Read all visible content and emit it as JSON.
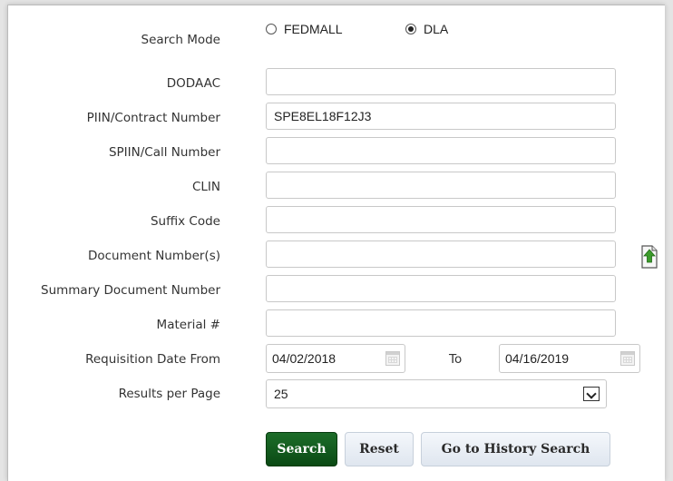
{
  "form": {
    "search_mode": {
      "label": "Search Mode",
      "options": [
        {
          "label": "FEDMALL",
          "checked": false
        },
        {
          "label": "DLA",
          "checked": true
        }
      ]
    },
    "dodaac": {
      "label": "DODAAC",
      "value": ""
    },
    "piin": {
      "label": "PIIN/Contract Number",
      "value": "SPE8EL18F12J3"
    },
    "spiin": {
      "label": "SPIIN/Call Number",
      "value": ""
    },
    "clin": {
      "label": "CLIN",
      "value": ""
    },
    "suffix": {
      "label": "Suffix Code",
      "value": ""
    },
    "document_numbers": {
      "label": "Document Number(s)",
      "value": ""
    },
    "summary_document": {
      "label": "Summary Document Number",
      "value": ""
    },
    "material": {
      "label": "Material #",
      "value": ""
    },
    "requisition_date": {
      "label": "Requisition Date From",
      "from": "04/02/2018",
      "to_label": "To",
      "to": "04/16/2019"
    },
    "results_per_page": {
      "label": "Results per Page",
      "value": "25"
    }
  },
  "buttons": {
    "search": "Search",
    "reset": "Reset",
    "history": "Go to History Search"
  },
  "icons": {
    "upload": "upload-document-icon",
    "calendar": "calendar-icon",
    "dropdown": "chevron-down-icon"
  },
  "colors": {
    "primary_button": "#0f5a1c",
    "upload_arrow": "#3c9b2b"
  }
}
